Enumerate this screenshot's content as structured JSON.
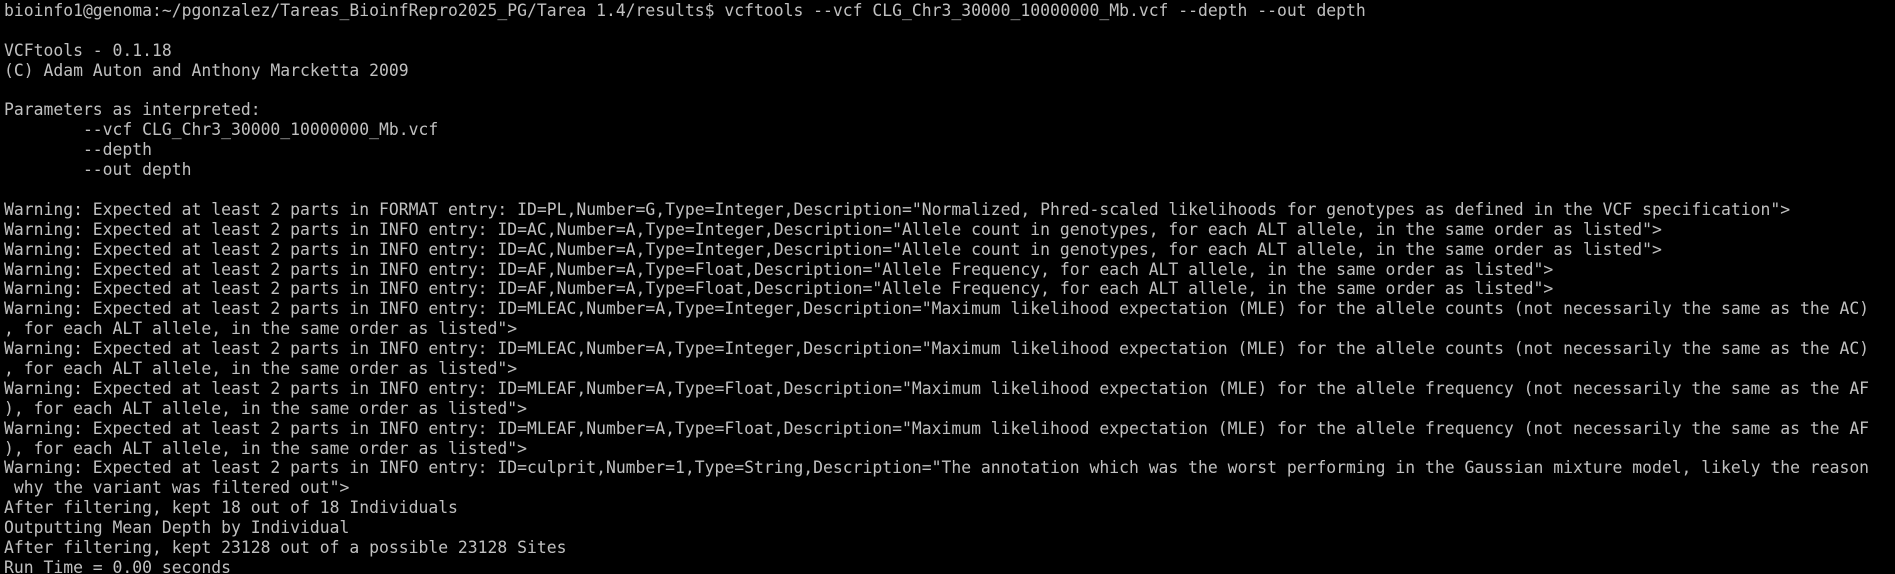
{
  "terminal": {
    "background": "#000000",
    "foreground": "#c0c0c0",
    "lines": [
      "bioinfo1@genoma:~/pgonzalez/Tareas_BioinfRepro2025_PG/Tarea 1.4/results$ vcftools --vcf CLG_Chr3_30000_10000000_Mb.vcf --depth --out depth",
      "",
      "VCFtools - 0.1.18",
      "(C) Adam Auton and Anthony Marcketta 2009",
      "",
      "Parameters as interpreted:",
      "        --vcf CLG_Chr3_30000_10000000_Mb.vcf",
      "        --depth",
      "        --out depth",
      "",
      "Warning: Expected at least 2 parts in FORMAT entry: ID=PL,Number=G,Type=Integer,Description=\"Normalized, Phred-scaled likelihoods for genotypes as defined in the VCF specification\">",
      "Warning: Expected at least 2 parts in INFO entry: ID=AC,Number=A,Type=Integer,Description=\"Allele count in genotypes, for each ALT allele, in the same order as listed\">",
      "Warning: Expected at least 2 parts in INFO entry: ID=AC,Number=A,Type=Integer,Description=\"Allele count in genotypes, for each ALT allele, in the same order as listed\">",
      "Warning: Expected at least 2 parts in INFO entry: ID=AF,Number=A,Type=Float,Description=\"Allele Frequency, for each ALT allele, in the same order as listed\">",
      "Warning: Expected at least 2 parts in INFO entry: ID=AF,Number=A,Type=Float,Description=\"Allele Frequency, for each ALT allele, in the same order as listed\">",
      "Warning: Expected at least 2 parts in INFO entry: ID=MLEAC,Number=A,Type=Integer,Description=\"Maximum likelihood expectation (MLE) for the allele counts (not necessarily the same as the AC)",
      ", for each ALT allele, in the same order as listed\">",
      "Warning: Expected at least 2 parts in INFO entry: ID=MLEAC,Number=A,Type=Integer,Description=\"Maximum likelihood expectation (MLE) for the allele counts (not necessarily the same as the AC)",
      ", for each ALT allele, in the same order as listed\">",
      "Warning: Expected at least 2 parts in INFO entry: ID=MLEAF,Number=A,Type=Float,Description=\"Maximum likelihood expectation (MLE) for the allele frequency (not necessarily the same as the AF",
      "), for each ALT allele, in the same order as listed\">",
      "Warning: Expected at least 2 parts in INFO entry: ID=MLEAF,Number=A,Type=Float,Description=\"Maximum likelihood expectation (MLE) for the allele frequency (not necessarily the same as the AF",
      "), for each ALT allele, in the same order as listed\">",
      "Warning: Expected at least 2 parts in INFO entry: ID=culprit,Number=1,Type=String,Description=\"The annotation which was the worst performing in the Gaussian mixture model, likely the reason",
      " why the variant was filtered out\">",
      "After filtering, kept 18 out of 18 Individuals",
      "Outputting Mean Depth by Individual",
      "After filtering, kept 23128 out of a possible 23128 Sites",
      "Run Time = 0.00 seconds"
    ]
  }
}
